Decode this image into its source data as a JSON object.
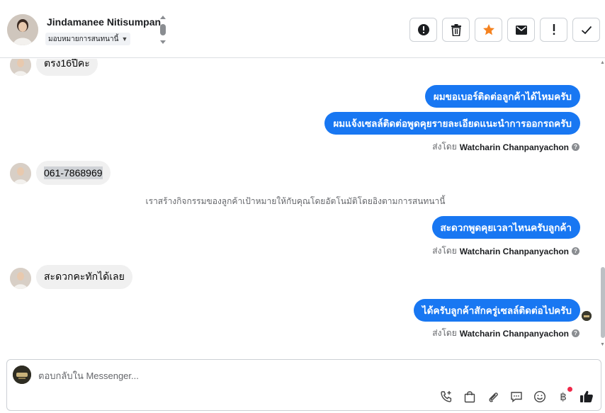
{
  "header": {
    "contact_name": "Jindamanee Nitisumpan",
    "assign_label": "มอบหมายการสนทนานี้",
    "actions": [
      {
        "name": "spam-button",
        "icon": "alert-circle-icon"
      },
      {
        "name": "delete-button",
        "icon": "trash-icon"
      },
      {
        "name": "star-button",
        "icon": "star-icon",
        "color": "#f5821f"
      },
      {
        "name": "email-button",
        "icon": "envelope-icon"
      },
      {
        "name": "important-button",
        "icon": "exclamation-icon"
      },
      {
        "name": "done-button",
        "icon": "checkmark-icon"
      }
    ]
  },
  "conversation": {
    "messages": [
      {
        "side": "in",
        "text": "ตรง16ปีคะ"
      },
      {
        "side": "out",
        "text": "ผมขอเบอร์ติดต่อลูกค้าได้ไหมครับ"
      },
      {
        "side": "out",
        "text": "ผมแจ้งเซลล์ติดต่อพูดคุยรายละเอียดแนะนำการออกรถครับ"
      },
      {
        "side": "in",
        "text": "061-7868969"
      },
      {
        "side": "system",
        "text": "เราสร้างกิจกรรมของลูกค้าเป้าหมายให้กับคุณโดยอัตโนมัติโดยอิงตามการสนทนานี้"
      },
      {
        "side": "out",
        "text": "สะดวกพูดคุยเวลาไหนครับลูกค้า"
      },
      {
        "side": "in",
        "text": "สะดวกคะทักได้เลย"
      },
      {
        "side": "out",
        "text": "ได้ครับลูกค้าสักครู่เซลล์ติดต่อไปครับ"
      }
    ],
    "sent_by_prefix": "ส่งโดย",
    "sent_by_name": "Watcharin Chanpanyachon"
  },
  "composer": {
    "placeholder": "ตอบกลับใน Messenger...",
    "tools": [
      "add-call-icon",
      "shopping-bag-icon",
      "paperclip-icon",
      "chat-bubble-icon",
      "emoji-icon",
      "baht-payment-icon",
      "thumbs-up-icon"
    ],
    "baht_symbol": "฿"
  },
  "colors": {
    "outgoing_bubble": "#1877f2",
    "incoming_bubble": "#f0f0f0",
    "star": "#f5821f"
  }
}
